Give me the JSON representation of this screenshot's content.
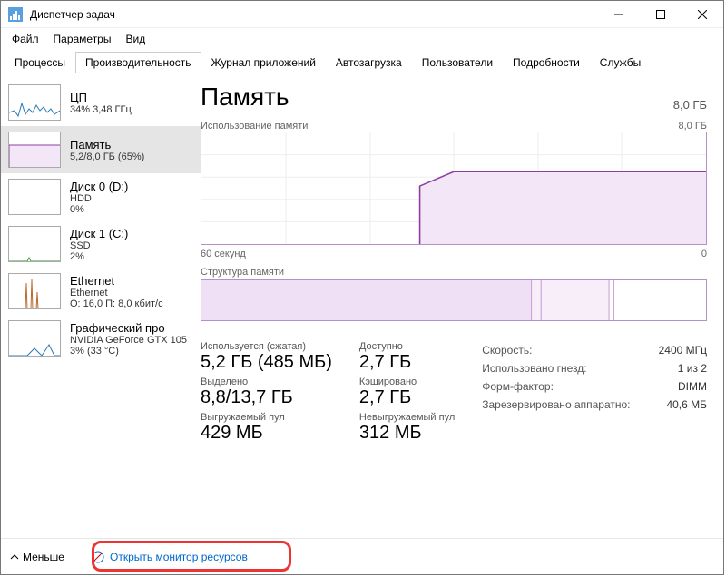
{
  "window": {
    "title": "Диспетчер задач"
  },
  "menu": {
    "file": "Файл",
    "options": "Параметры",
    "view": "Вид"
  },
  "tabs": {
    "items": [
      "Процессы",
      "Производительность",
      "Журнал приложений",
      "Автозагрузка",
      "Пользователи",
      "Подробности",
      "Службы"
    ],
    "activeIndex": 1
  },
  "sidebar": {
    "items": [
      {
        "name": "ЦП",
        "sub": "34% 3,48 ГГц",
        "thumbColor": "#2a7ab8"
      },
      {
        "name": "Память",
        "sub": "5,2/8,0 ГБ (65%)",
        "thumbColor": "#8b3fa0"
      },
      {
        "name": "Диск 0 (D:)",
        "sub": "HDD",
        "sub2": "0%",
        "thumbColor": "#3a9a3a"
      },
      {
        "name": "Диск 1 (C:)",
        "sub": "SSD",
        "sub2": "2%",
        "thumbColor": "#3a9a3a"
      },
      {
        "name": "Ethernet",
        "sub": "Ethernet",
        "sub2": "О: 16,0 П: 8,0 кбит/с",
        "thumbColor": "#b86a2a"
      },
      {
        "name": "Графический про",
        "sub": "NVIDIA GeForce GTX 105",
        "sub2": "3% (33 °C)",
        "thumbColor": "#2a7ab8"
      }
    ],
    "activeIndex": 1
  },
  "main": {
    "title": "Память",
    "total": "8,0 ГБ",
    "chart1": {
      "label": "Использование памяти",
      "labelRight": "8,0 ГБ",
      "xleft": "60 секунд",
      "xright": "0"
    },
    "chart2": {
      "label": "Структура памяти"
    },
    "stats": {
      "col1": [
        {
          "label": "Используется (сжатая)",
          "value": "5,2 ГБ (485 МБ)"
        },
        {
          "label": "Выделено",
          "value": "8,8/13,7 ГБ"
        },
        {
          "label": "Выгружаемый пул",
          "value": "429 МБ"
        }
      ],
      "col2": [
        {
          "label": "Доступно",
          "value": "2,7 ГБ"
        },
        {
          "label": "Кэшировано",
          "value": "2,7 ГБ"
        },
        {
          "label": "Невыгружаемый пул",
          "value": "312 МБ"
        }
      ],
      "kv": [
        {
          "k": "Скорость:",
          "v": "2400 МГц"
        },
        {
          "k": "Использовано гнезд:",
          "v": "1 из 2"
        },
        {
          "k": "Форм-фактор:",
          "v": "DIMM"
        },
        {
          "k": "Зарезервировано аппаратно:",
          "v": "40,6 МБ"
        }
      ]
    }
  },
  "footer": {
    "less": "Меньше",
    "link": "Открыть монитор ресурсов"
  },
  "chart_data": {
    "type": "area",
    "title": "Использование памяти",
    "xlabel": "секунд",
    "ylabel": "ГБ",
    "xlim": [
      60,
      0
    ],
    "ylim": [
      0,
      8.0
    ],
    "series": [
      {
        "name": "Память",
        "x": [
          60,
          40,
          34,
          30,
          0
        ],
        "values": [
          null,
          null,
          4.2,
          5.2,
          5.2
        ]
      }
    ]
  }
}
